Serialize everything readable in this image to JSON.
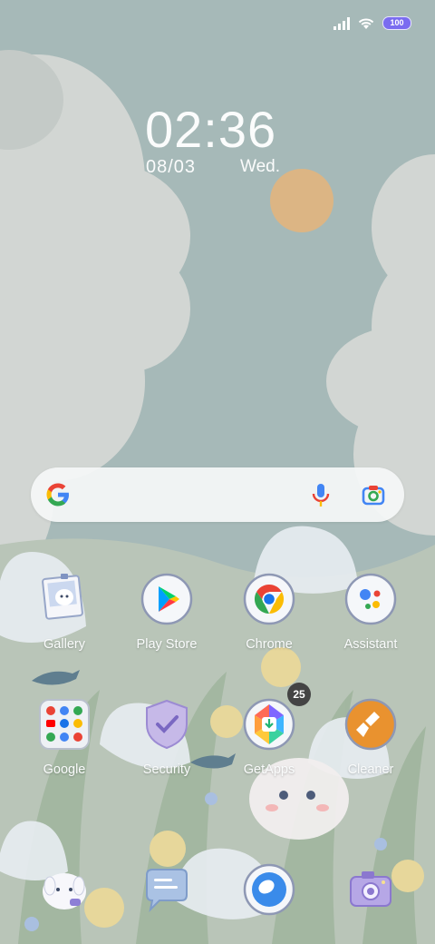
{
  "status_bar": {
    "battery": "100"
  },
  "clock": {
    "time": "02:36",
    "date": "08/03",
    "weekday": "Wed."
  },
  "search": {
    "label": "Google search"
  },
  "apps_row1": [
    {
      "label": "Gallery",
      "icon": "gallery-icon"
    },
    {
      "label": "Play Store",
      "icon": "play-store-icon"
    },
    {
      "label": "Chrome",
      "icon": "chrome-icon"
    },
    {
      "label": "Assistant",
      "icon": "assistant-icon"
    }
  ],
  "apps_row2": [
    {
      "label": "Google",
      "icon": "google-folder-icon"
    },
    {
      "label": "Security",
      "icon": "security-icon"
    },
    {
      "label": "GetApps",
      "icon": "getapps-icon",
      "badge": "25"
    },
    {
      "label": "Cleaner",
      "icon": "cleaner-icon"
    }
  ],
  "dock": [
    {
      "icon": "phone-icon"
    },
    {
      "icon": "messages-icon"
    },
    {
      "icon": "browser-icon"
    },
    {
      "icon": "camera-icon"
    }
  ],
  "colors": {
    "sky": "#a6b9b8",
    "sun": "#e7b77a",
    "cloud": "#d3d7d4",
    "accent_battery": "#7a6cf0"
  }
}
